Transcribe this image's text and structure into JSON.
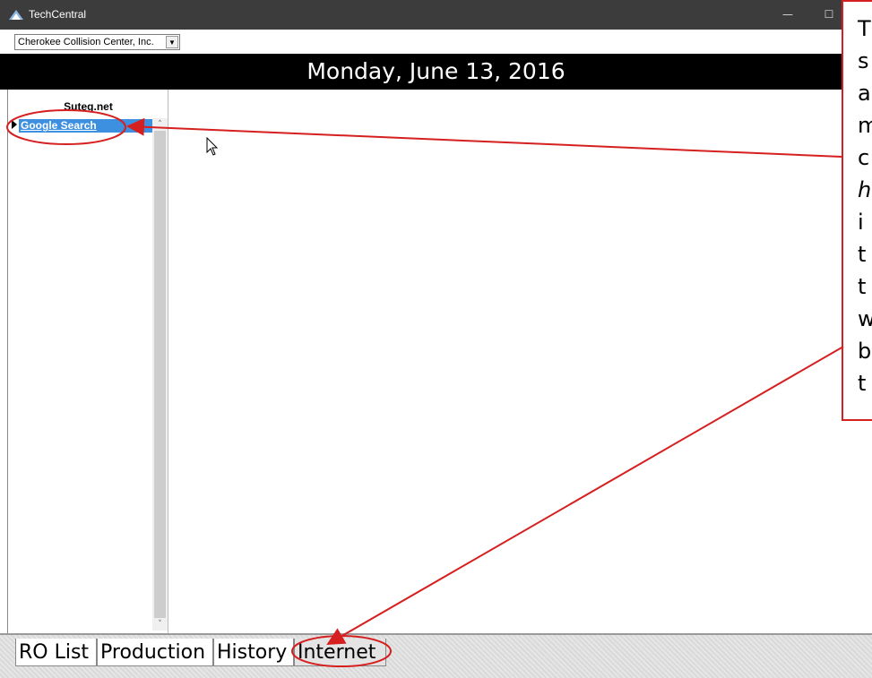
{
  "window": {
    "title": "TechCentral",
    "minimize_glyph": "—",
    "maximize_glyph": "☐"
  },
  "company_selector": {
    "selected": "Cherokee Collision Center, Inc."
  },
  "date_banner": "Monday, June 13, 2016",
  "link_list": {
    "header": "Suteg.net",
    "items": [
      {
        "label": "Google Search"
      }
    ]
  },
  "tabs": [
    {
      "label": "RO List",
      "active": false
    },
    {
      "label": "Production",
      "active": false
    },
    {
      "label": "History",
      "active": false
    },
    {
      "label": "Internet",
      "active": true
    }
  ],
  "annotation": {
    "visible_line_starts": [
      "T",
      "s",
      "a",
      "m",
      "c",
      "h",
      "i",
      "t",
      "t",
      "w",
      "b",
      "t"
    ],
    "colors": {
      "outline": "#d62020",
      "arrow": "#d62020"
    }
  },
  "colors": {
    "titlebar": "#3c3c3c",
    "date_banner_bg": "#000000",
    "selected_row": "#3d8fe0"
  }
}
